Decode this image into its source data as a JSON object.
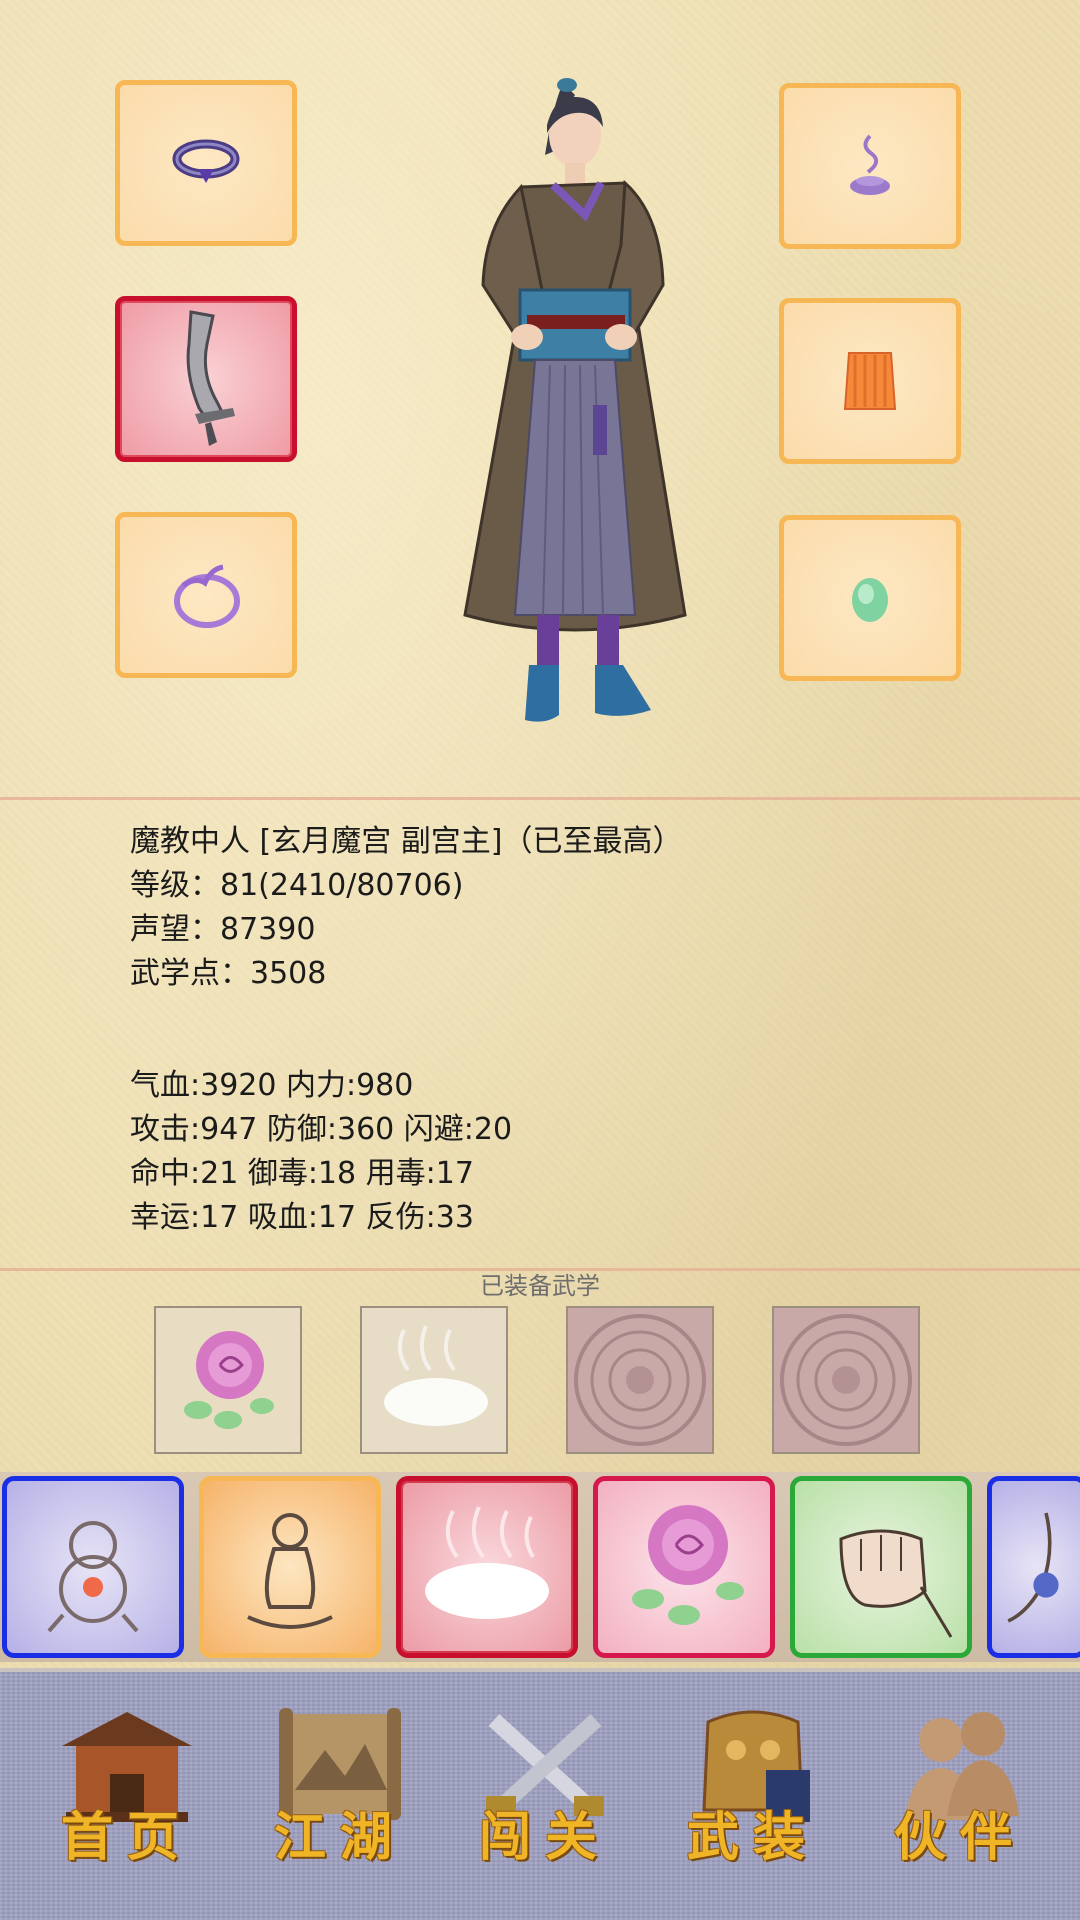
{
  "character": {
    "title_line": "魔教中人 [玄月魔宫 副宫主]（已至最高）",
    "level_line": "等级：81(2410/80706)",
    "reputation_line": "声望：87390",
    "martial_points_line": "武学点：3508"
  },
  "stats": {
    "line1": "气血:3920  内力:980",
    "line2": "攻击:947  防御:360  闪避:20",
    "line3": "命中:21  御毒:18  用毒:17",
    "line4": "幸运:17  吸血:17  反伤:33"
  },
  "equipped_section": {
    "label": "已装备武学"
  },
  "equipment_slots": [
    {
      "icon": "ring-icon",
      "selected": false
    },
    {
      "icon": "sword-icon",
      "selected": true
    },
    {
      "icon": "bracelet-icon",
      "selected": false
    },
    {
      "icon": "incense-icon",
      "selected": false
    },
    {
      "icon": "armor-vest-icon",
      "selected": false
    },
    {
      "icon": "jade-stone-icon",
      "selected": false
    }
  ],
  "equipped_skills": [
    {
      "icon": "rose-skill-icon",
      "state": "equipped"
    },
    {
      "icon": "mist-skill-icon",
      "state": "equipped"
    },
    {
      "icon": "empty-slot-icon",
      "state": "empty"
    },
    {
      "icon": "empty-slot-icon",
      "state": "empty"
    }
  ],
  "skill_list": [
    {
      "icon": "gourd-skill-icon",
      "rarity_color": "#1a2ee6"
    },
    {
      "icon": "meditation-skill-icon",
      "rarity_color": "#f7b754"
    },
    {
      "icon": "mist-skill-icon",
      "rarity_color": "#c8102e",
      "selected": true
    },
    {
      "icon": "rose-skill-icon",
      "rarity_color": "#d6184d"
    },
    {
      "icon": "fist-skill-icon",
      "rarity_color": "#2aa838"
    },
    {
      "icon": "palm-skill-icon",
      "rarity_color": "#1a2ee6"
    }
  ],
  "nav": {
    "home": "首页",
    "jianghu": "江湖",
    "challenge": "闯关",
    "equipment": "武装",
    "partner": "伙伴"
  },
  "colors": {
    "slot_border": "#f7b754",
    "slot_selected_border": "#c8102e",
    "nav_label": "#f0b527",
    "nav_background": "#9ea0c1"
  }
}
